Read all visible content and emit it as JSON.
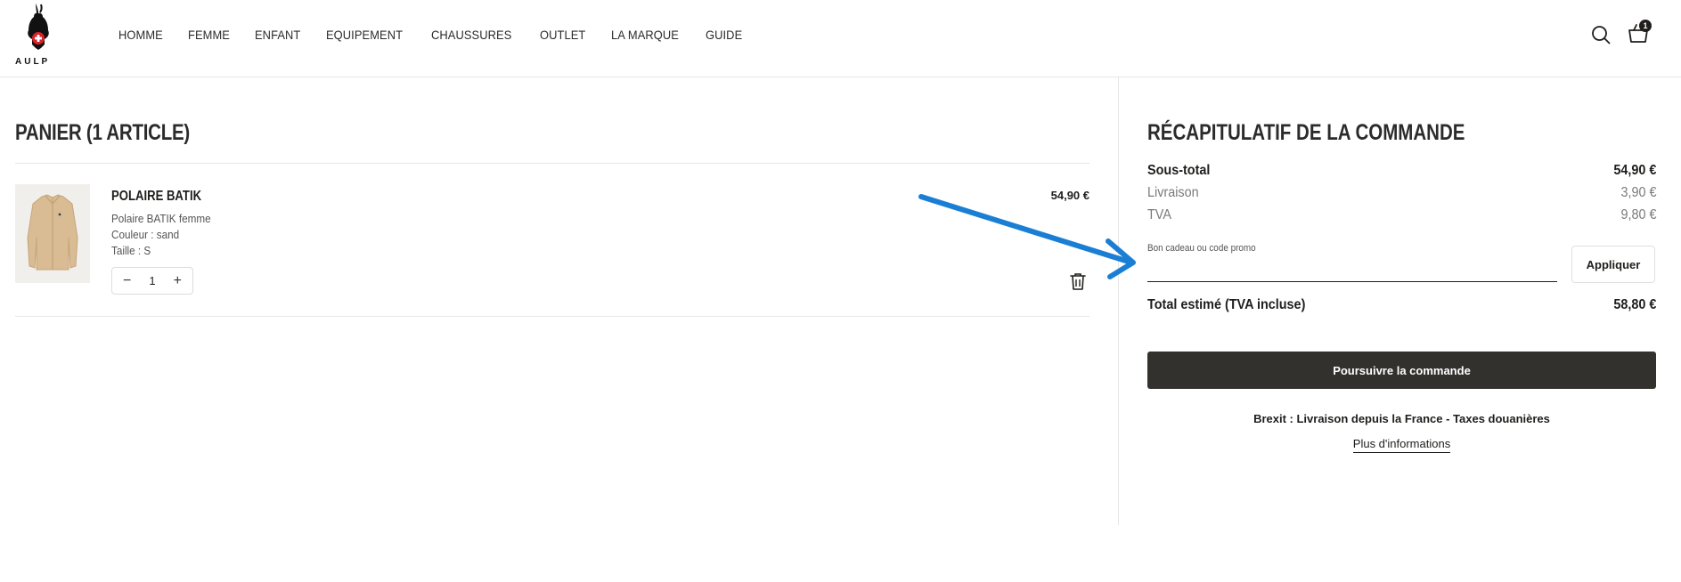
{
  "brand": {
    "name": "AULP"
  },
  "nav": {
    "items": [
      "HOMME",
      "FEMME",
      "ENFANT",
      "EQUIPEMENT",
      "CHAUSSURES",
      "OUTLET",
      "LA MARQUE",
      "GUIDE"
    ]
  },
  "header": {
    "search_icon": "search-icon",
    "cart_icon": "basket-icon",
    "cart_count": "1"
  },
  "cart": {
    "title": "PANIER (1 ARTICLE)",
    "item": {
      "name": "POLAIRE BATIK",
      "description": "Polaire BATIK femme",
      "color": "Couleur : sand",
      "size": "Taille : S",
      "price": "54,90 €",
      "quantity": "1",
      "qty_minus": "−",
      "qty_plus": "+"
    }
  },
  "summary": {
    "title": "RÉCAPITULATIF DE LA COMMANDE",
    "subtotal_label": "Sous-total",
    "subtotal_value": "54,90 €",
    "shipping_label": "Livraison",
    "shipping_value": "3,90 €",
    "tax_label": "TVA",
    "tax_value": "9,80 €",
    "promo_label": "Bon cadeau ou code promo",
    "promo_value": "",
    "apply_label": "Appliquer",
    "total_label": "Total estimé (TVA incluse)",
    "total_value": "58,80 €",
    "checkout_label": "Poursuivre la commande",
    "brexit_text": "Brexit : Livraison depuis la France - Taxes douanières",
    "more_info_label": "Plus d'informations"
  },
  "colors": {
    "dark": "#33312e",
    "annotation_arrow": "#1a7fd4"
  }
}
